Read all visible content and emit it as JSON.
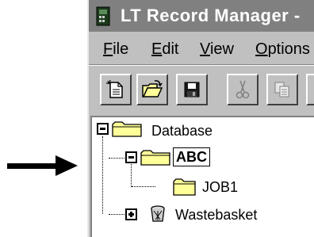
{
  "window": {
    "title": "LT Record Manager -"
  },
  "menu": {
    "items": [
      {
        "label": "File",
        "mnemonic": "F",
        "rest": "ile"
      },
      {
        "label": "Edit",
        "mnemonic": "E",
        "rest": "dit"
      },
      {
        "label": "View",
        "mnemonic": "V",
        "rest": "iew"
      },
      {
        "label": "Options",
        "mnemonic": "O",
        "rest": "ptions"
      }
    ]
  },
  "toolbar": {
    "buttons": [
      {
        "icon": "new-record-icon"
      },
      {
        "icon": "open-folder-icon"
      },
      {
        "icon": "save-disk-icon"
      },
      {
        "icon": "cut-scissors-icon"
      },
      {
        "icon": "copy-icon"
      }
    ]
  },
  "tree": {
    "nodes": [
      {
        "label": "Database",
        "level": 0,
        "state": "expanded",
        "icon": "folder-icon"
      },
      {
        "label": "ABC",
        "level": 1,
        "state": "expanded",
        "selected": true,
        "icon": "folder-icon"
      },
      {
        "label": "JOB1",
        "level": 2,
        "state": "leaf",
        "icon": "folder-icon"
      },
      {
        "label": "Wastebasket",
        "level": 1,
        "state": "collapsed",
        "icon": "wastebasket-icon"
      }
    ]
  },
  "colors": {
    "titlebar": "#808080",
    "face": "#c0c0c0",
    "folder": "#ffff99"
  }
}
